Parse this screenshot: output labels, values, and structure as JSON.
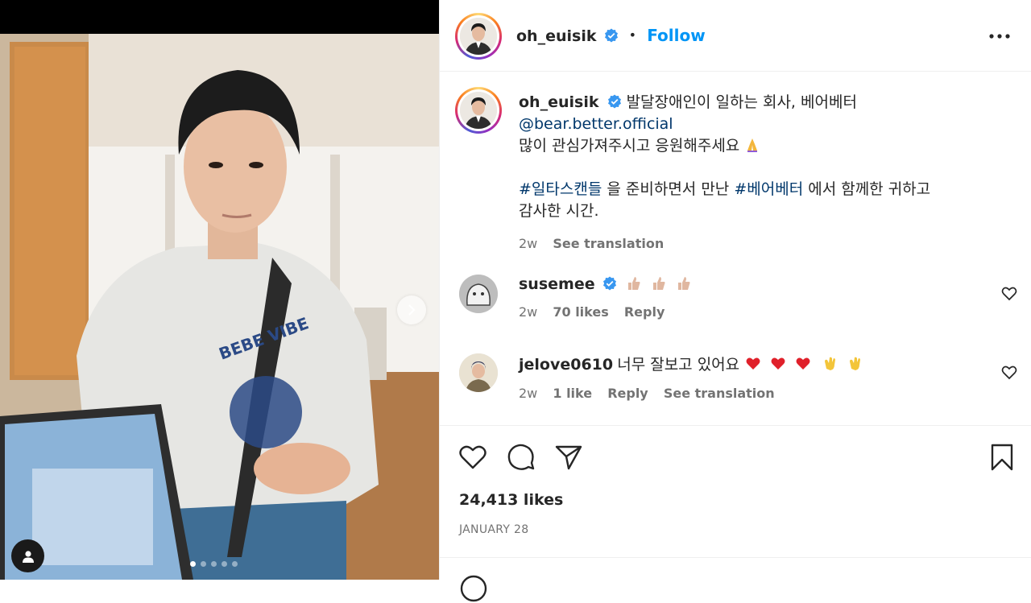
{
  "post": {
    "author": "oh_euisik",
    "follow_label": "Follow",
    "separator": "•",
    "caption_line1": "발달장애인이 일하는 회사, 베어베터",
    "caption_mention": "@bear.better.official",
    "caption_line2": "많이 관심가져주시고 응원해주세요",
    "caption_hashtag1": "#일타스캔들",
    "caption_mid": " 을 준비하면서 만난 ",
    "caption_hashtag2": "#베어베터",
    "caption_end1": " 에서 함께한 귀하고",
    "caption_end2": "감사한 시간.",
    "caption_time": "2w",
    "see_translation": "See translation",
    "likes": "24,413 likes",
    "date": "JANUARY 28"
  },
  "comments": [
    {
      "user": "susemee",
      "verified": true,
      "text": "",
      "emoji": "thumbs-up x3",
      "time": "2w",
      "likes": "70 likes",
      "reply": "Reply"
    },
    {
      "user": "jelove0610",
      "verified": false,
      "text": "너무 잘보고 있어요",
      "emoji": "hearts x3, clap x2",
      "time": "2w",
      "likes": "1 like",
      "reply": "Reply",
      "see_translation": "See translation"
    }
  ],
  "carousel": {
    "slides": 5,
    "current": 1
  },
  "icons": [
    "verified-badge-icon",
    "more-options-icon",
    "heart-icon",
    "comment-icon",
    "share-icon",
    "bookmark-icon",
    "chevron-right-icon",
    "user-tag-icon"
  ],
  "colors": {
    "accent": "#0095f6",
    "link": "#00376b",
    "muted": "#737373",
    "text": "#262626"
  }
}
